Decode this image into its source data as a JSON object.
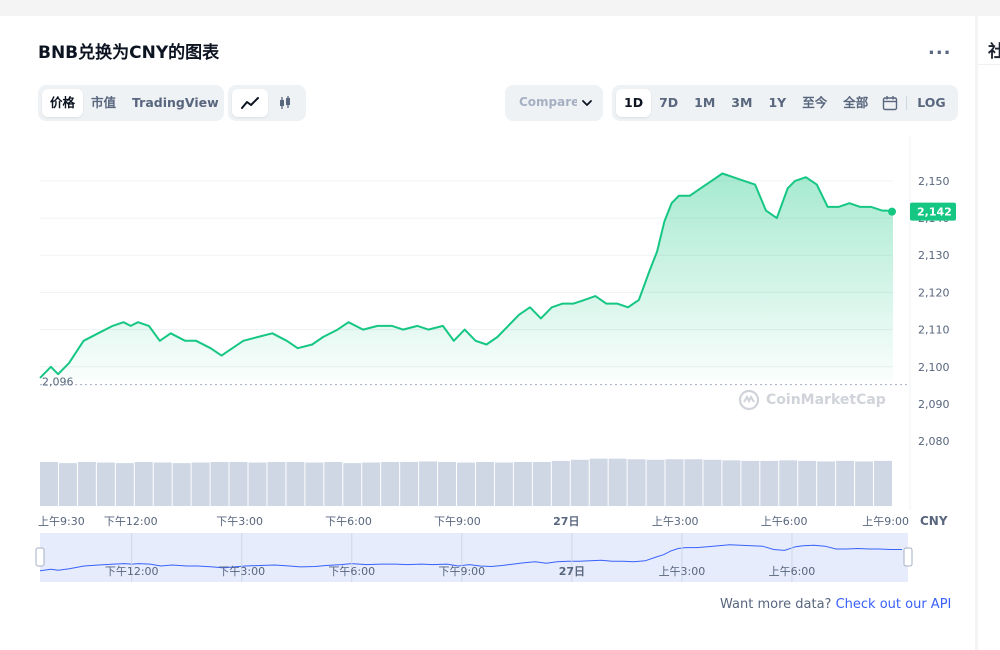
{
  "header": {
    "title": "BNB兑换为CNY的图表",
    "more": "..."
  },
  "side": {
    "title": "社"
  },
  "view_tabs": [
    {
      "label": "价格",
      "active": true
    },
    {
      "label": "市值"
    },
    {
      "label": "TradingView"
    }
  ],
  "chart_mode": [
    {
      "icon": "line-chart-icon",
      "active": true
    },
    {
      "icon": "candlestick-icon"
    }
  ],
  "compare": {
    "label": "Compare with"
  },
  "range_tabs": [
    {
      "label": "1D",
      "active": true
    },
    {
      "label": "7D"
    },
    {
      "label": "1M"
    },
    {
      "label": "3M"
    },
    {
      "label": "1Y"
    },
    {
      "label": "至今"
    },
    {
      "label": "全部"
    }
  ],
  "log_label": "LOG",
  "watermark": "CoinMarketCap",
  "footer": {
    "text": "Want more data?",
    "link": "Check out our API"
  },
  "chart_data": {
    "type": "area",
    "currency": "CNY",
    "y_ticks": [
      2080,
      2090,
      2100,
      2110,
      2120,
      2130,
      2140,
      2150
    ],
    "y_tick_labels": [
      "2,080",
      "2,090",
      "2,100",
      "2,110",
      "2,120",
      "2,130",
      "2,140",
      "2,150"
    ],
    "ylim": [
      2076,
      2161
    ],
    "x_ticks": [
      0,
      2.5,
      5.5,
      8.5,
      11.5,
      14.5,
      17.5,
      20.5,
      23.5
    ],
    "x_tick_labels": [
      "上午9:30",
      "下午12:00",
      "下午3:00",
      "下午6:00",
      "下午9:00",
      "27日",
      "上午3:00",
      "上午6:00",
      "上午9:00"
    ],
    "navigator_tick_labels": [
      "下午12:00",
      "下午3:00",
      "下午6:00",
      "下午9:00",
      "27日",
      "上午3:00",
      "上午6:00"
    ],
    "navigator_ticks": [
      2.5,
      5.5,
      8.5,
      11.5,
      14.5,
      17.5,
      20.5
    ],
    "xlim": [
      0,
      23.5
    ],
    "open_price": 2096,
    "open_label": "2,096",
    "current_price": 2142,
    "current_label": "2,142",
    "grid": true,
    "series": [
      {
        "x": [
          0,
          0.3,
          0.5,
          0.8,
          1.2,
          1.6,
          2.0,
          2.3,
          2.5,
          2.7,
          3.0,
          3.3,
          3.6,
          4.0,
          4.3,
          4.7,
          5.0,
          5.3,
          5.6,
          6.0,
          6.4,
          6.8,
          7.1,
          7.5,
          7.8,
          8.2,
          8.5,
          8.9,
          9.3,
          9.7,
          10.0,
          10.4,
          10.7,
          11.1,
          11.4,
          11.7,
          12.0,
          12.3,
          12.6,
          12.9,
          13.2,
          13.5,
          13.8,
          14.1,
          14.4,
          14.7,
          15.0,
          15.3,
          15.6,
          15.9,
          16.2,
          16.5,
          16.8,
          17.0,
          17.2,
          17.4,
          17.6,
          17.9,
          18.2,
          18.5,
          18.8,
          19.1,
          19.4,
          19.7,
          20.0,
          20.3,
          20.6,
          20.8,
          21.1,
          21.4,
          21.7,
          22.0,
          22.3,
          22.6,
          22.9,
          23.2,
          23.5
        ],
        "y": [
          2097,
          2100,
          2098,
          2101,
          2107,
          2109,
          2111,
          2112,
          2111,
          2112,
          2111,
          2107,
          2109,
          2107,
          2107,
          2105,
          2103,
          2105,
          2107,
          2108,
          2109,
          2107,
          2105,
          2106,
          2108,
          2110,
          2112,
          2110,
          2111,
          2111,
          2110,
          2111,
          2110,
          2111,
          2107,
          2110,
          2107,
          2106,
          2108,
          2111,
          2114,
          2116,
          2113,
          2116,
          2117,
          2117,
          2118,
          2119,
          2117,
          2117,
          2116,
          2118,
          2126,
          2131,
          2139,
          2144,
          2146,
          2146,
          2148,
          2150,
          2152,
          2151,
          2150,
          2149,
          2142,
          2140,
          2148,
          2150,
          2151,
          2149,
          2143,
          2143,
          2144,
          2143,
          2143,
          2142,
          2142
        ]
      }
    ],
    "volume": [
      0.8,
      0.78,
      0.8,
      0.79,
      0.78,
      0.8,
      0.79,
      0.78,
      0.79,
      0.8,
      0.8,
      0.79,
      0.8,
      0.8,
      0.79,
      0.8,
      0.78,
      0.79,
      0.8,
      0.8,
      0.81,
      0.8,
      0.79,
      0.8,
      0.79,
      0.8,
      0.8,
      0.82,
      0.84,
      0.86,
      0.86,
      0.85,
      0.84,
      0.85,
      0.85,
      0.84,
      0.83,
      0.82,
      0.82,
      0.83,
      0.82,
      0.81,
      0.82,
      0.81,
      0.82
    ]
  },
  "colors": {
    "line": "#16c784",
    "fill_top": "#16c784",
    "grid": "#eff2f5",
    "text": "#58667e",
    "volume": "#cfd6e4",
    "navigator": "#e6ecfc",
    "navigator_line": "#3861fb",
    "badge_text": "#ffffff"
  }
}
